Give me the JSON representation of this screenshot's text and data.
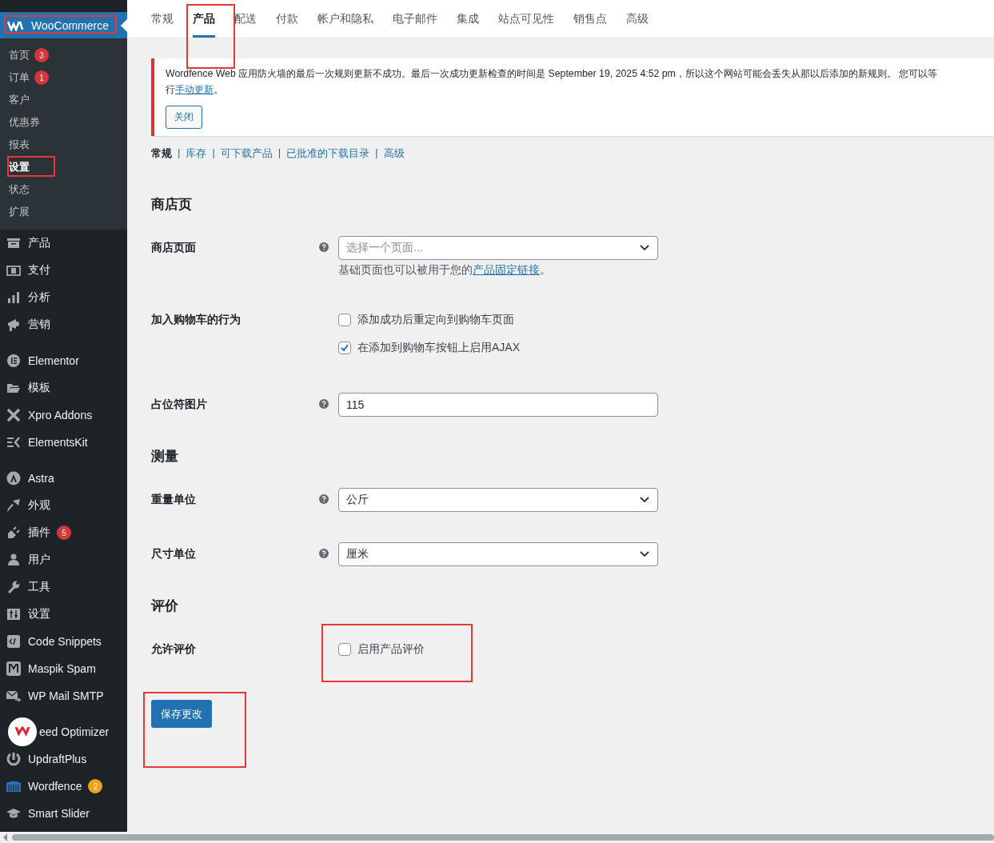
{
  "sidebar": {
    "header": {
      "label": "WooCommerce",
      "selected": true
    },
    "submenu": [
      {
        "label": "首页",
        "selected": false,
        "badge": {
          "count": "3",
          "color": "#d63638"
        }
      },
      {
        "label": "订单",
        "selected": false,
        "badge": {
          "count": "1",
          "color": "#d63638"
        }
      },
      {
        "label": "客户",
        "selected": false
      },
      {
        "label": "优惠券",
        "selected": false
      },
      {
        "label": "报表",
        "selected": false
      },
      {
        "label": "设置",
        "selected": true
      },
      {
        "label": "状态",
        "selected": false
      },
      {
        "label": "扩展",
        "selected": false
      }
    ],
    "menu_groups": [
      [
        {
          "label": "产品"
        },
        {
          "label": "支付"
        },
        {
          "label": "分析"
        },
        {
          "label": "营销"
        }
      ],
      [
        {
          "label": "Elementor"
        },
        {
          "label": "模板"
        },
        {
          "label": "Xpro Addons"
        },
        {
          "label": "ElementsKit"
        }
      ],
      [
        {
          "label": "Astra"
        },
        {
          "label": "外观"
        },
        {
          "label": "插件",
          "badge": {
            "count": "5",
            "color": "#d63638"
          }
        },
        {
          "label": "用户"
        },
        {
          "label": "工具"
        },
        {
          "label": "设置"
        },
        {
          "label": "Code Snippets"
        },
        {
          "label": "Maspik Spam"
        },
        {
          "label": "WP Mail SMTP"
        }
      ],
      [
        {
          "label": "eed Optimizer",
          "covered": true
        },
        {
          "label": "UpdraftPlus"
        },
        {
          "label": "Wordfence",
          "badge": {
            "count": "2",
            "color": "#f0a21b"
          }
        },
        {
          "label": "Smart Slider"
        }
      ]
    ]
  },
  "tabs": [
    {
      "label": "常规",
      "selected": false
    },
    {
      "label": "产品",
      "selected": true
    },
    {
      "label": "配送",
      "selected": false
    },
    {
      "label": "付款",
      "selected": false
    },
    {
      "label": "帐户和隐私",
      "selected": false
    },
    {
      "label": "电子邮件",
      "selected": false
    },
    {
      "label": "集成",
      "selected": false
    },
    {
      "label": "站点可见性",
      "selected": false
    },
    {
      "label": "销售点",
      "selected": false
    },
    {
      "label": "高级",
      "selected": false
    }
  ],
  "notice": {
    "line_1": "Wordfence Web 应用防火墙的最后一次规则更新不成功。最后一次成功更新检查的时间是 September 19, 2025 4:52 pm，所以这个网站可能会丢失从那以后添加的新规则。 您可以等",
    "line_2_prefix": "行",
    "link": "手动更新",
    "line_2_suffix": "。",
    "button": "关闭"
  },
  "subnav": [
    {
      "label": "常规",
      "selected": true
    },
    {
      "label": "库存",
      "selected": false,
      "separator": "|"
    },
    {
      "label": "可下载产品",
      "selected": false,
      "separator": "|"
    },
    {
      "label": "已批准的下载目录",
      "selected": false,
      "separator": "|"
    },
    {
      "label": "高级",
      "selected": false,
      "separator": "|"
    }
  ],
  "sections": [
    {
      "title": "商店页",
      "rows": [
        {
          "label": "商店页面",
          "help": true,
          "kind": "select",
          "placeholder": "选择一个页面...",
          "description": "基础页面也可以被用于您的",
          "description_link": "产品固定链接",
          "description_suffix": "。"
        },
        {
          "label": "加入购物车的行为",
          "help": false,
          "kind": "checkboxes",
          "options": [
            {
              "label": "添加成功后重定向到购物车页面",
              "checked": false
            },
            {
              "label": "在添加到购物车按钮上启用AJAX",
              "checked": true
            }
          ]
        },
        {
          "label": "占位符图片",
          "help": true,
          "kind": "input",
          "value": "115"
        }
      ]
    },
    {
      "title": "测量",
      "rows": [
        {
          "label": "重量单位",
          "help": true,
          "kind": "select",
          "value": "公斤"
        },
        {
          "label": "尺寸单位",
          "help": true,
          "kind": "select",
          "value": "厘米"
        }
      ]
    },
    {
      "title": "评价",
      "rows": [
        {
          "label": "允许评价",
          "help": false,
          "kind": "checkboxes",
          "options": [
            {
              "label": "启用产品评价",
              "checked": false
            }
          ]
        }
      ]
    }
  ],
  "save_button": "保存更改"
}
